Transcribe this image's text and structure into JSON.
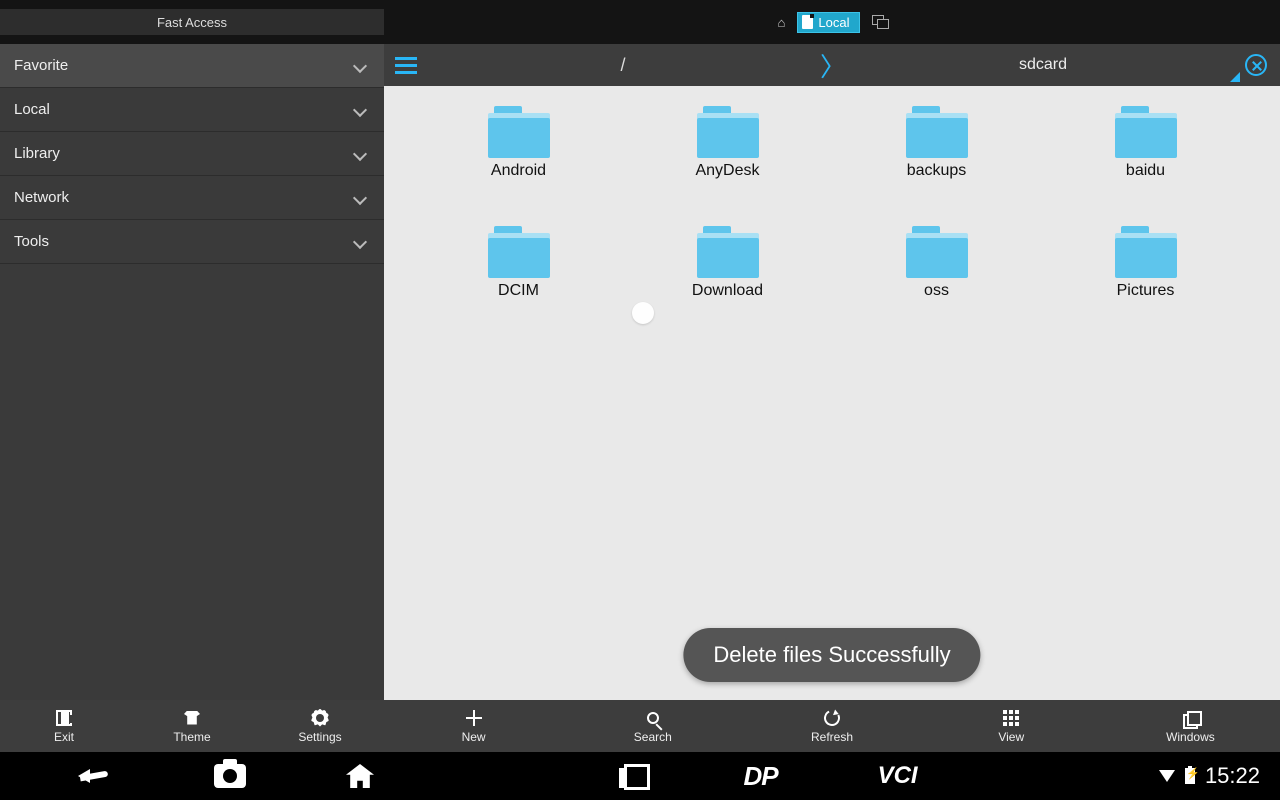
{
  "sidebar": {
    "header": "Fast Access",
    "items": [
      "Favorite",
      "Local",
      "Library",
      "Network",
      "Tools"
    ]
  },
  "tabs": {
    "active": "Local"
  },
  "path": {
    "root": "/",
    "current": "sdcard"
  },
  "folders": [
    "Android",
    "AnyDesk",
    "backups",
    "baidu",
    "DCIM",
    "Download",
    "oss",
    "Pictures"
  ],
  "toast": "Delete files Successfully",
  "toolbar": {
    "left": [
      "Exit",
      "Theme",
      "Settings"
    ],
    "right": [
      "New",
      "Search",
      "Refresh",
      "View",
      "Windows"
    ]
  },
  "nav": {
    "dp": "DP",
    "vci": "VCI"
  },
  "status": {
    "time": "15:22"
  }
}
